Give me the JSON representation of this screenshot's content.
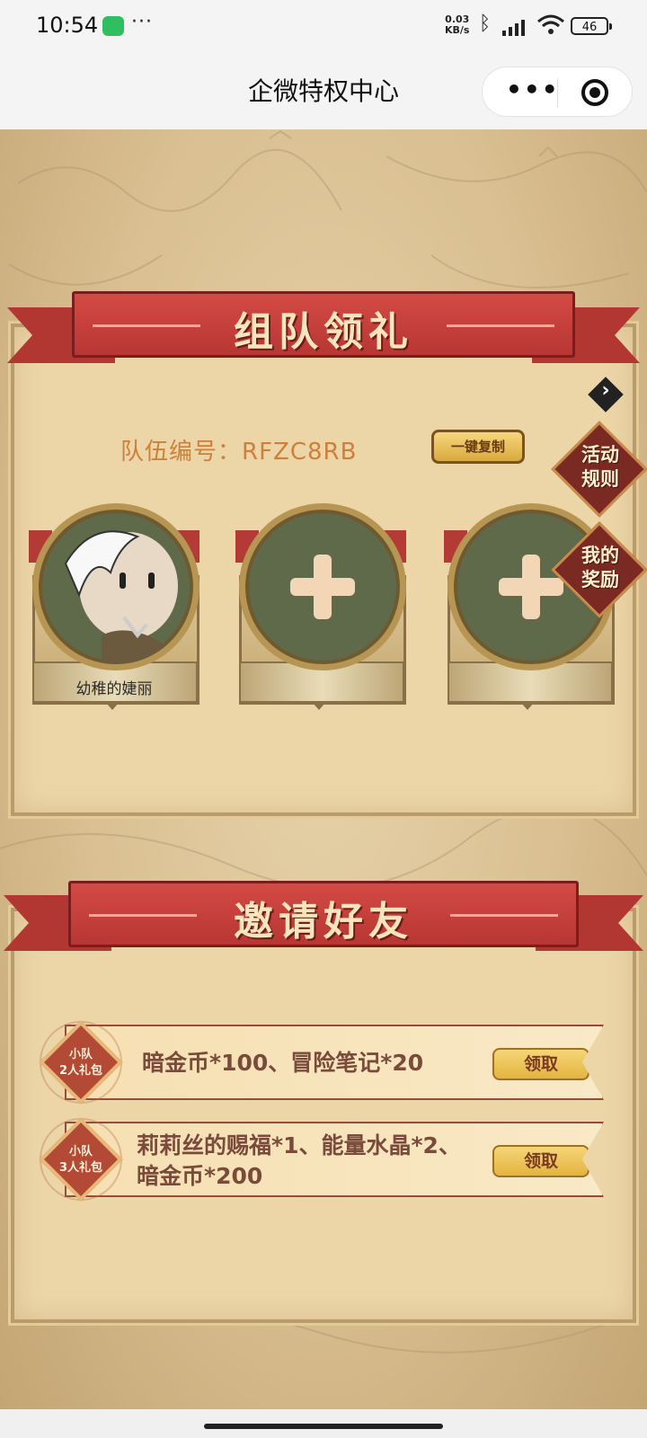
{
  "status_bar": {
    "time": "10:54",
    "more": "···",
    "net_speed_value": "0.03",
    "net_speed_unit": "KB/s",
    "battery": "46",
    "icons": [
      "wechat-icon",
      "bluetooth-icon",
      "signal-icon",
      "wifi-icon",
      "battery-icon"
    ]
  },
  "nav": {
    "title": "企微特权中心",
    "more_icon": "•••",
    "close_icon": "record-icon"
  },
  "team": {
    "banner_title": "组队领礼",
    "team_id_label": "队伍编号：RFZC8RB",
    "copy_label": "一键复制",
    "rules_label_1": "活动",
    "rules_label_2": "规则",
    "my_rewards_label_1": "我的",
    "my_rewards_label_2": "奖励",
    "members": [
      {
        "name": "幼稚的婕丽",
        "filled": true
      },
      {
        "name": "",
        "filled": false
      },
      {
        "name": "",
        "filled": false
      }
    ]
  },
  "invite": {
    "banner_title": "邀请好友",
    "rewards": [
      {
        "badge_line1": "小队",
        "badge_line2": "2人礼包",
        "text_line1": "暗金币*100、冒险笔记*20",
        "text_line2": "",
        "button": "领取"
      },
      {
        "badge_line1": "小队",
        "badge_line2": "3人礼包",
        "text_line1": "莉莉丝的赐福*1、能量水晶*2、",
        "text_line2": "暗金币*200",
        "button": "领取"
      }
    ]
  },
  "colors": {
    "ribbon_red": "#c0403c",
    "panel_bg": "#ecd6a8",
    "team_id_text": "#cf7f3a",
    "claim_button": "#eec25a"
  }
}
